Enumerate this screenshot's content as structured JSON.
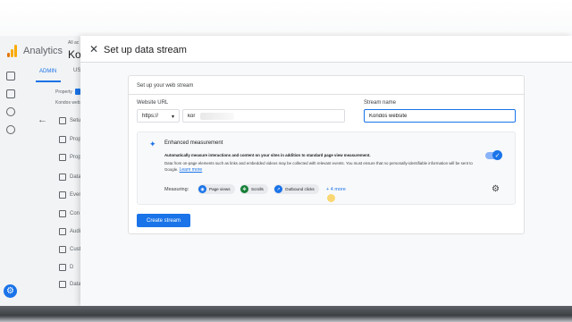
{
  "background_app": {
    "app_name": "Analytics",
    "account_small": "All ac",
    "account_name": "Kon",
    "tab_admin": "ADMIN",
    "tab_user": "US",
    "property_label": "Property",
    "property_sub": "Kondos webs",
    "side_items": [
      "Setu",
      "Prop",
      "Prop Man",
      "Data",
      "Even",
      "Con",
      "Audi",
      "Cust",
      "D",
      "Data"
    ]
  },
  "panel": {
    "title": "Set up data stream",
    "card_title": "Set up your web stream",
    "website_url_label": "Website URL",
    "protocol_value": "https://",
    "url_value": "kor",
    "stream_name_label": "Stream name",
    "stream_name_value": "Kondos website",
    "enhanced": {
      "title": "Enhanced measurement",
      "desc_bold": "Automatically measure interactions and content on your sites in addition to standard page view measurement.",
      "desc": "Data from on-page elements such as links and embedded videos may be collected with relevant events. You must ensure that no personally-identifiable information will be sent to Google.",
      "learn_more": "Learn more",
      "toggle_on": true,
      "measuring_label": "Measuring:",
      "chips": [
        {
          "label": "Page views",
          "icon": "eye-icon",
          "color": "#1a73e8"
        },
        {
          "label": "Scrolls",
          "icon": "scroll-icon",
          "color": "#188038"
        },
        {
          "label": "Outbound clicks",
          "icon": "cursor-icon",
          "color": "#1a73e8"
        }
      ],
      "more": "+ 4 more"
    },
    "create_button": "Create stream"
  },
  "colors": {
    "accent": "#1a73e8",
    "ga_orange": "#f9ab00"
  }
}
